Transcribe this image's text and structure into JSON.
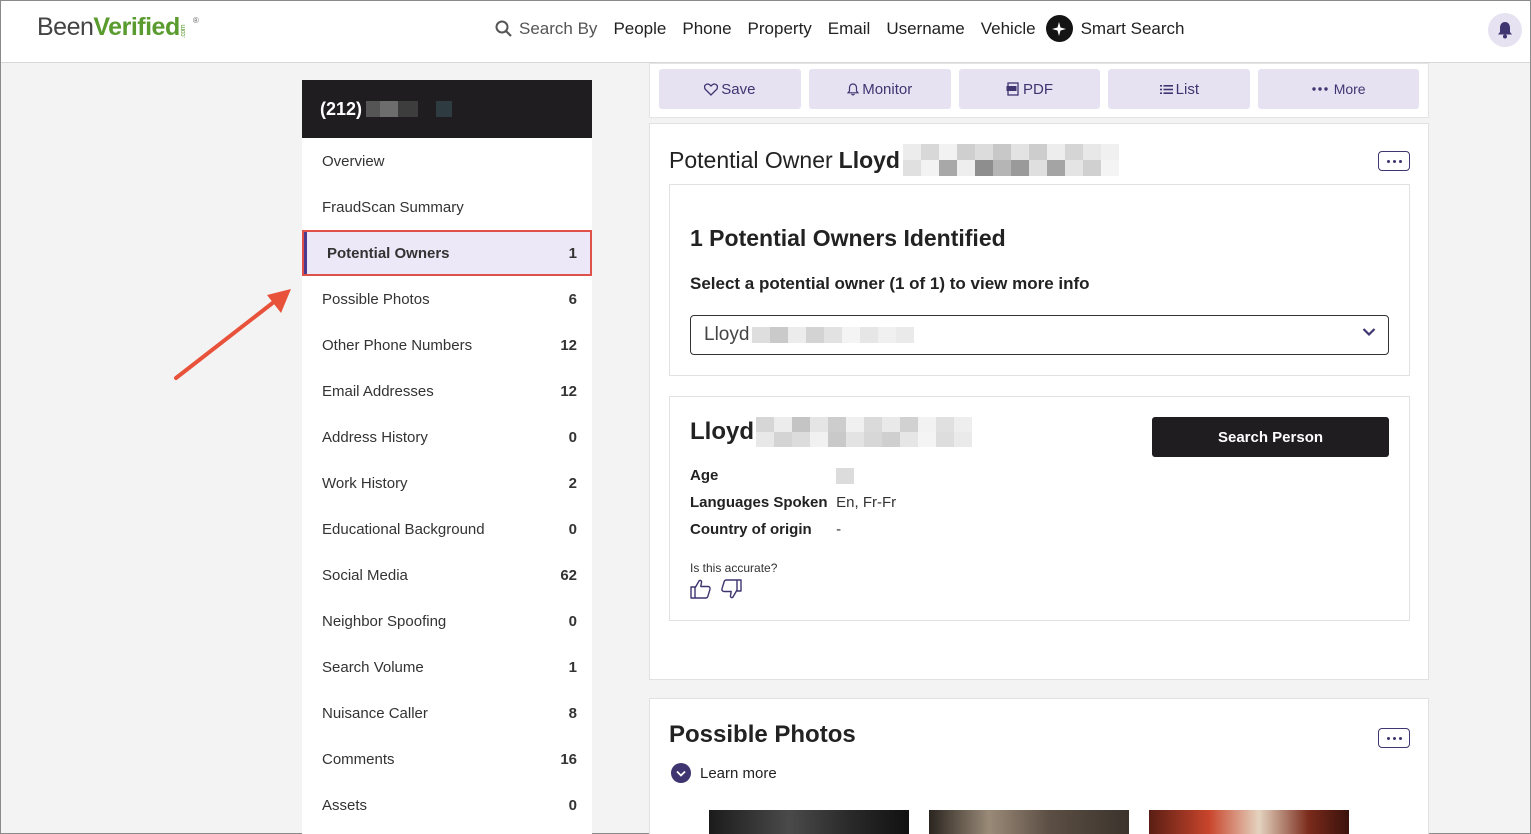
{
  "header": {
    "logo_been": "Been",
    "logo_verified": "Verified",
    "logo_com": ".com",
    "logo_reg": "®",
    "search_by": "Search By",
    "nav": [
      "People",
      "Phone",
      "Property",
      "Email",
      "Username",
      "Vehicle"
    ],
    "smart_search": "Smart Search"
  },
  "sidebar": {
    "phone_prefix": "(212)",
    "items": [
      {
        "label": "Overview",
        "count": ""
      },
      {
        "label": "FraudScan Summary",
        "count": ""
      },
      {
        "label": "Potential Owners",
        "count": "1"
      },
      {
        "label": "Possible Photos",
        "count": "6"
      },
      {
        "label": "Other Phone Numbers",
        "count": "12"
      },
      {
        "label": "Email Addresses",
        "count": "12"
      },
      {
        "label": "Address History",
        "count": "0"
      },
      {
        "label": "Work History",
        "count": "2"
      },
      {
        "label": "Educational Background",
        "count": "0"
      },
      {
        "label": "Social Media",
        "count": "62"
      },
      {
        "label": "Neighbor Spoofing",
        "count": "0"
      },
      {
        "label": "Search Volume",
        "count": "1"
      },
      {
        "label": "Nuisance Caller",
        "count": "8"
      },
      {
        "label": "Comments",
        "count": "16"
      },
      {
        "label": "Assets",
        "count": "0"
      }
    ]
  },
  "toolbar": {
    "save": "Save",
    "monitor": "Monitor",
    "pdf": "PDF",
    "list": "List",
    "more": "More"
  },
  "potential_owner": {
    "title_prefix": "Potential Owner",
    "title_name": "Lloyd",
    "identified": "1 Potential Owners Identified",
    "select_prompt": "Select a potential owner (1 of 1) to view more info",
    "selected_value": "Lloyd",
    "person_name": "Lloyd",
    "search_person": "Search Person",
    "age_label": "Age",
    "age_value": "",
    "languages_label": "Languages Spoken",
    "languages_value": "En, Fr-Fr",
    "country_label": "Country of origin",
    "country_value": "-",
    "accurate_question": "Is this accurate?"
  },
  "possible_photos": {
    "title": "Possible Photos",
    "learn_more": "Learn more"
  },
  "colors": {
    "accent": "#3f3570",
    "accent_light": "#e6e2f2",
    "dark": "#1f1d1f",
    "logo_green": "#5a9b2f",
    "highlight_red": "#e0504a"
  }
}
